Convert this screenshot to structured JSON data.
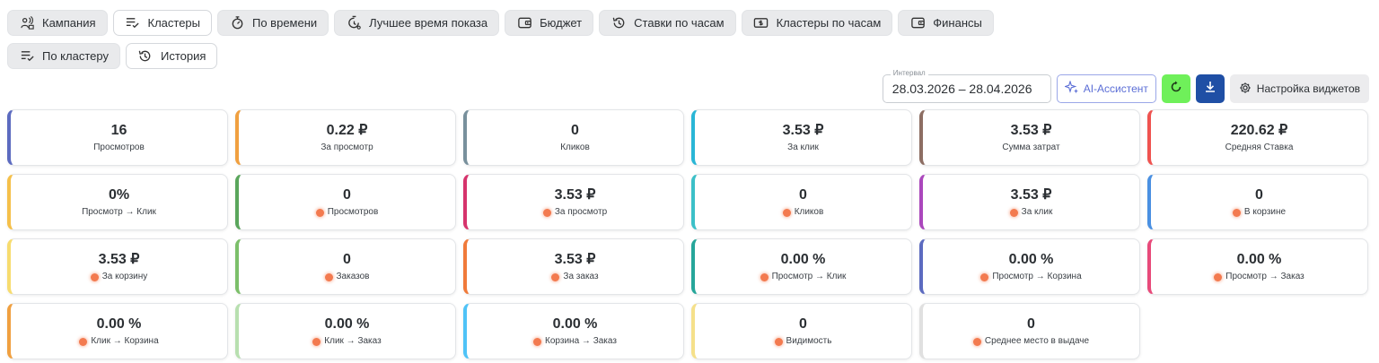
{
  "tabs_row1": [
    {
      "label": "Кампания",
      "icon": "campaign-icon",
      "active": false
    },
    {
      "label": "Кластеры",
      "icon": "list-check-icon",
      "active": true
    },
    {
      "label": "По времени",
      "icon": "stopwatch-icon",
      "active": false
    },
    {
      "label": "Лучшее время показа",
      "icon": "timer-settings-icon",
      "active": false
    },
    {
      "label": "Бюджет",
      "icon": "wallet-icon",
      "active": false
    },
    {
      "label": "Ставки по часам",
      "icon": "history-icon",
      "active": false
    },
    {
      "label": "Кластеры по часам",
      "icon": "money-icon",
      "active": false
    },
    {
      "label": "Финансы",
      "icon": "wallet-icon",
      "active": false
    }
  ],
  "tabs_row2": [
    {
      "label": "По кластеру",
      "icon": "list-check-icon",
      "active": false
    },
    {
      "label": "История",
      "icon": "history-icon",
      "active": true
    }
  ],
  "toolbar": {
    "interval_label": "Интервал",
    "interval_value": "28.03.2026 – 28.04.2026",
    "ai_label": "AI-Ассистент",
    "settings_label": "Настройка виджетов",
    "ai_color": "#5b6ed6",
    "refresh_color": "#6ff05a",
    "download_color": "#1f4fa5"
  },
  "metrics": [
    {
      "value": "16",
      "label": "Просмотров",
      "color": "#5c6bc0",
      "dot": false
    },
    {
      "value": "0.22 ₽",
      "label": "За просмотр",
      "color": "#f0a040",
      "dot": false
    },
    {
      "value": "0",
      "label": "Кликов",
      "color": "#78909c",
      "dot": false
    },
    {
      "value": "3.53 ₽",
      "label": "За клик",
      "color": "#29b6d6",
      "dot": false
    },
    {
      "value": "3.53 ₽",
      "label": "Сумма затрат",
      "color": "#8d6e63",
      "dot": false
    },
    {
      "value": "220.62 ₽",
      "label": "Средняя Ставка",
      "color": "#ef5350",
      "dot": false
    },
    {
      "value": "0%",
      "label": "Просмотр → Клик",
      "color": "#f5c04a",
      "dot": false
    },
    {
      "value": "0",
      "label": "Просмотров",
      "color": "#5aa65c",
      "dot": true
    },
    {
      "value": "3.53 ₽",
      "label": "За просмотр",
      "color": "#d6336c",
      "dot": true
    },
    {
      "value": "0",
      "label": "Кликов",
      "color": "#3cc0c8",
      "dot": true
    },
    {
      "value": "3.53 ₽",
      "label": "За клик",
      "color": "#ab47bc",
      "dot": true
    },
    {
      "value": "0",
      "label": "В корзине",
      "color": "#4a90e2",
      "dot": true
    },
    {
      "value": "3.53 ₽",
      "label": "За корзину",
      "color": "#f7dc6f",
      "dot": true
    },
    {
      "value": "0",
      "label": "Заказов",
      "color": "#7cbf6a",
      "dot": true
    },
    {
      "value": "3.53 ₽",
      "label": "За заказ",
      "color": "#f07a3a",
      "dot": true
    },
    {
      "value": "0.00 %",
      "label": "Просмотр → Клик",
      "color": "#26a69a",
      "dot": true
    },
    {
      "value": "0.00 %",
      "label": "Просмотр → Корзина",
      "color": "#5c6bc0",
      "dot": true
    },
    {
      "value": "0.00 %",
      "label": "Просмотр → Заказ",
      "color": "#e84a7a",
      "dot": true
    },
    {
      "value": "0.00 %",
      "label": "Клик → Корзина",
      "color": "#f0a040",
      "dot": true
    },
    {
      "value": "0.00 %",
      "label": "Клик → Заказ",
      "color": "#b8e0b0",
      "dot": true
    },
    {
      "value": "0.00 %",
      "label": "Корзина → Заказ",
      "color": "#4fc3f7",
      "dot": true
    },
    {
      "value": "0",
      "label": "Видимость",
      "color": "#f5e08a",
      "dot": true
    },
    {
      "value": "0",
      "label": "Среднее место в выдаче",
      "color": "#e0e0e0",
      "dot": true
    }
  ]
}
